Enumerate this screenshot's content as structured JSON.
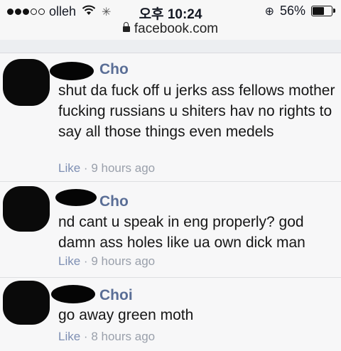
{
  "status": {
    "carrier": "olleh",
    "time": "오후 10:24",
    "battery": "56%",
    "battery_level": 0.56
  },
  "browser": {
    "url": "facebook.com"
  },
  "comments": [
    {
      "name_suffix": "Cho",
      "text": "shut da fuck off u jerks ass fellows mother fucking russians u shiters hav no rights to say all those things even medels",
      "like": "Like",
      "sep": "·",
      "time": "9 hours ago"
    },
    {
      "name_suffix": "Cho",
      "text": "nd cant u speak in eng properly? god damn ass holes like ua own dick man",
      "like": "Like",
      "sep": "·",
      "time": "9 hours ago"
    },
    {
      "name_suffix": "Choi",
      "text": "go away green moth",
      "like": "Like",
      "sep": "·",
      "time": "8 hours ago"
    }
  ]
}
